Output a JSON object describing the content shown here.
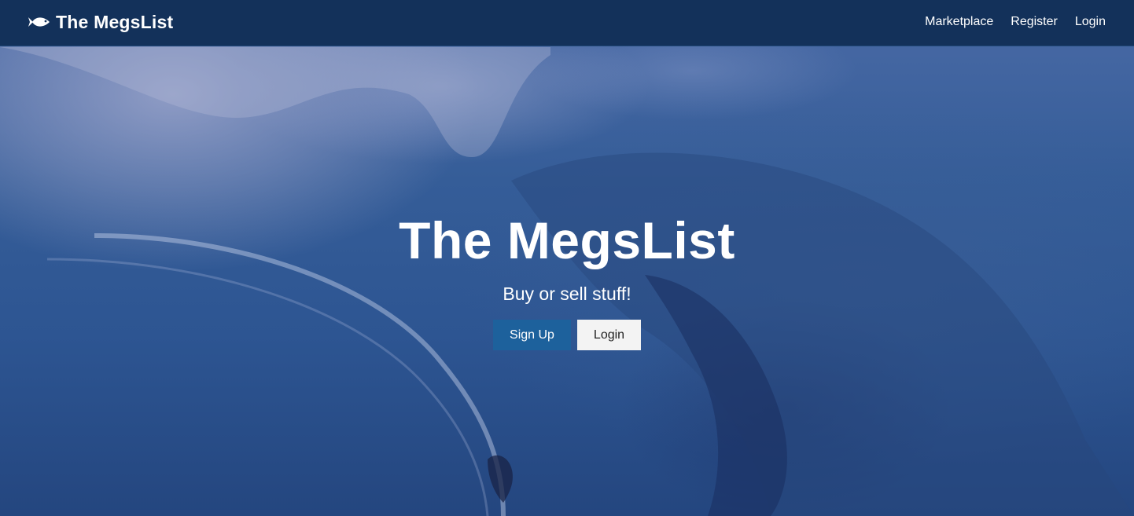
{
  "navbar": {
    "brand_icon": "fish-icon",
    "brand": "The MegsList",
    "links": [
      {
        "label": "Marketplace"
      },
      {
        "label": "Register"
      },
      {
        "label": "Login"
      }
    ],
    "background": "#13315a"
  },
  "hero": {
    "background_image": "ocean-wave-shark-surfer",
    "title": "The MegsList",
    "subtitle": "Buy or sell stuff!",
    "primary_button": "Sign Up",
    "secondary_button": "Login",
    "primary_color": "#1d619c"
  }
}
